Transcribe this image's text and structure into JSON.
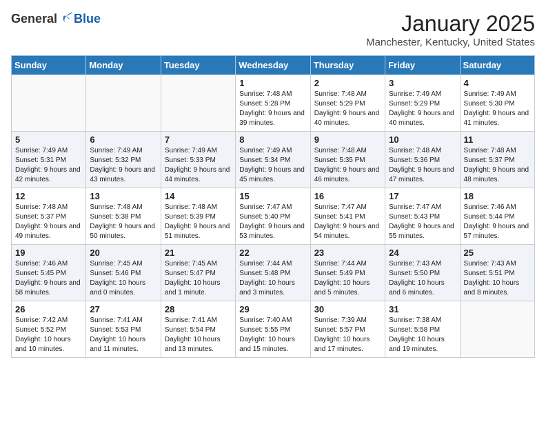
{
  "header": {
    "logo_general": "General",
    "logo_blue": "Blue",
    "month_title": "January 2025",
    "location": "Manchester, Kentucky, United States"
  },
  "days_of_week": [
    "Sunday",
    "Monday",
    "Tuesday",
    "Wednesday",
    "Thursday",
    "Friday",
    "Saturday"
  ],
  "weeks": [
    [
      {
        "day": "",
        "info": ""
      },
      {
        "day": "",
        "info": ""
      },
      {
        "day": "",
        "info": ""
      },
      {
        "day": "1",
        "info": "Sunrise: 7:48 AM\nSunset: 5:28 PM\nDaylight: 9 hours and 39 minutes."
      },
      {
        "day": "2",
        "info": "Sunrise: 7:48 AM\nSunset: 5:29 PM\nDaylight: 9 hours and 40 minutes."
      },
      {
        "day": "3",
        "info": "Sunrise: 7:49 AM\nSunset: 5:29 PM\nDaylight: 9 hours and 40 minutes."
      },
      {
        "day": "4",
        "info": "Sunrise: 7:49 AM\nSunset: 5:30 PM\nDaylight: 9 hours and 41 minutes."
      }
    ],
    [
      {
        "day": "5",
        "info": "Sunrise: 7:49 AM\nSunset: 5:31 PM\nDaylight: 9 hours and 42 minutes."
      },
      {
        "day": "6",
        "info": "Sunrise: 7:49 AM\nSunset: 5:32 PM\nDaylight: 9 hours and 43 minutes."
      },
      {
        "day": "7",
        "info": "Sunrise: 7:49 AM\nSunset: 5:33 PM\nDaylight: 9 hours and 44 minutes."
      },
      {
        "day": "8",
        "info": "Sunrise: 7:49 AM\nSunset: 5:34 PM\nDaylight: 9 hours and 45 minutes."
      },
      {
        "day": "9",
        "info": "Sunrise: 7:48 AM\nSunset: 5:35 PM\nDaylight: 9 hours and 46 minutes."
      },
      {
        "day": "10",
        "info": "Sunrise: 7:48 AM\nSunset: 5:36 PM\nDaylight: 9 hours and 47 minutes."
      },
      {
        "day": "11",
        "info": "Sunrise: 7:48 AM\nSunset: 5:37 PM\nDaylight: 9 hours and 48 minutes."
      }
    ],
    [
      {
        "day": "12",
        "info": "Sunrise: 7:48 AM\nSunset: 5:37 PM\nDaylight: 9 hours and 49 minutes."
      },
      {
        "day": "13",
        "info": "Sunrise: 7:48 AM\nSunset: 5:38 PM\nDaylight: 9 hours and 50 minutes."
      },
      {
        "day": "14",
        "info": "Sunrise: 7:48 AM\nSunset: 5:39 PM\nDaylight: 9 hours and 51 minutes."
      },
      {
        "day": "15",
        "info": "Sunrise: 7:47 AM\nSunset: 5:40 PM\nDaylight: 9 hours and 53 minutes."
      },
      {
        "day": "16",
        "info": "Sunrise: 7:47 AM\nSunset: 5:41 PM\nDaylight: 9 hours and 54 minutes."
      },
      {
        "day": "17",
        "info": "Sunrise: 7:47 AM\nSunset: 5:43 PM\nDaylight: 9 hours and 55 minutes."
      },
      {
        "day": "18",
        "info": "Sunrise: 7:46 AM\nSunset: 5:44 PM\nDaylight: 9 hours and 57 minutes."
      }
    ],
    [
      {
        "day": "19",
        "info": "Sunrise: 7:46 AM\nSunset: 5:45 PM\nDaylight: 9 hours and 58 minutes."
      },
      {
        "day": "20",
        "info": "Sunrise: 7:45 AM\nSunset: 5:46 PM\nDaylight: 10 hours and 0 minutes."
      },
      {
        "day": "21",
        "info": "Sunrise: 7:45 AM\nSunset: 5:47 PM\nDaylight: 10 hours and 1 minute."
      },
      {
        "day": "22",
        "info": "Sunrise: 7:44 AM\nSunset: 5:48 PM\nDaylight: 10 hours and 3 minutes."
      },
      {
        "day": "23",
        "info": "Sunrise: 7:44 AM\nSunset: 5:49 PM\nDaylight: 10 hours and 5 minutes."
      },
      {
        "day": "24",
        "info": "Sunrise: 7:43 AM\nSunset: 5:50 PM\nDaylight: 10 hours and 6 minutes."
      },
      {
        "day": "25",
        "info": "Sunrise: 7:43 AM\nSunset: 5:51 PM\nDaylight: 10 hours and 8 minutes."
      }
    ],
    [
      {
        "day": "26",
        "info": "Sunrise: 7:42 AM\nSunset: 5:52 PM\nDaylight: 10 hours and 10 minutes."
      },
      {
        "day": "27",
        "info": "Sunrise: 7:41 AM\nSunset: 5:53 PM\nDaylight: 10 hours and 11 minutes."
      },
      {
        "day": "28",
        "info": "Sunrise: 7:41 AM\nSunset: 5:54 PM\nDaylight: 10 hours and 13 minutes."
      },
      {
        "day": "29",
        "info": "Sunrise: 7:40 AM\nSunset: 5:55 PM\nDaylight: 10 hours and 15 minutes."
      },
      {
        "day": "30",
        "info": "Sunrise: 7:39 AM\nSunset: 5:57 PM\nDaylight: 10 hours and 17 minutes."
      },
      {
        "day": "31",
        "info": "Sunrise: 7:38 AM\nSunset: 5:58 PM\nDaylight: 10 hours and 19 minutes."
      },
      {
        "day": "",
        "info": ""
      }
    ]
  ]
}
